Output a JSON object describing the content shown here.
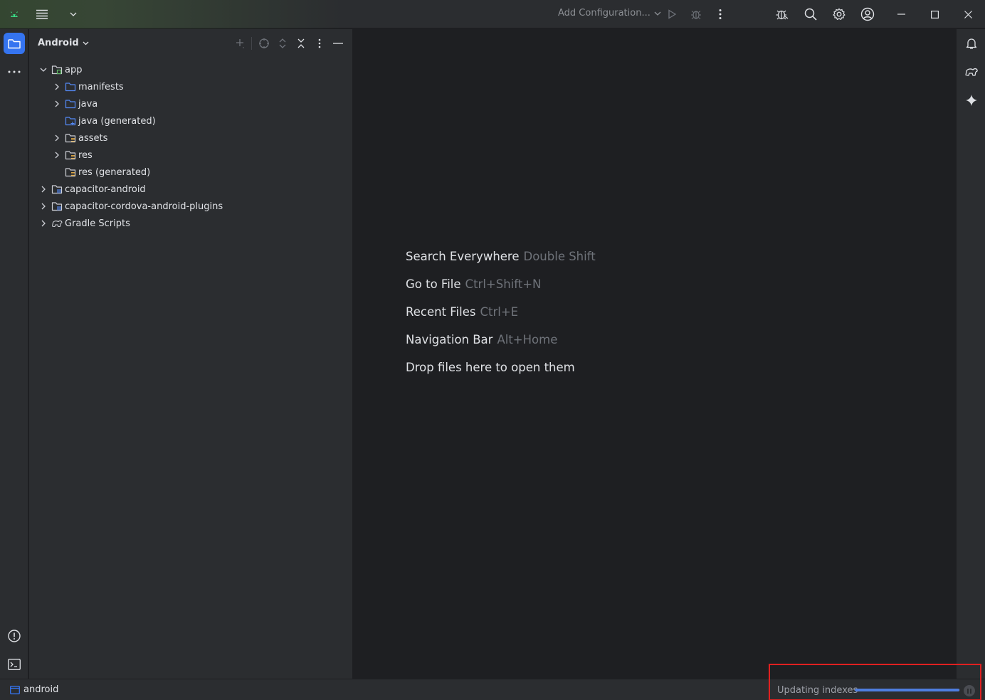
{
  "titlebar": {
    "run_config_label": "Add Configuration..."
  },
  "project_panel": {
    "view_mode": "Android",
    "tree": [
      {
        "label": "app",
        "depth": 0,
        "expanded": true,
        "has_chevron": true,
        "icon": "module-icon"
      },
      {
        "label": "manifests",
        "depth": 1,
        "expanded": false,
        "has_chevron": true,
        "icon": "folder-icon"
      },
      {
        "label": "java",
        "depth": 1,
        "expanded": false,
        "has_chevron": true,
        "icon": "folder-icon"
      },
      {
        "label": "java (generated)",
        "depth": 1,
        "expanded": false,
        "has_chevron": false,
        "icon": "generated-folder-icon"
      },
      {
        "label": "assets",
        "depth": 1,
        "expanded": false,
        "has_chevron": true,
        "icon": "resource-folder-icon"
      },
      {
        "label": "res",
        "depth": 1,
        "expanded": false,
        "has_chevron": true,
        "icon": "resource-folder-icon"
      },
      {
        "label": "res (generated)",
        "depth": 1,
        "expanded": false,
        "has_chevron": false,
        "icon": "resource-folder-icon"
      },
      {
        "label": "capacitor-android",
        "depth": 0,
        "expanded": false,
        "has_chevron": true,
        "icon": "library-module-icon"
      },
      {
        "label": "capacitor-cordova-android-plugins",
        "depth": 0,
        "expanded": false,
        "has_chevron": true,
        "icon": "library-module-icon"
      },
      {
        "label": "Gradle Scripts",
        "depth": 0,
        "expanded": false,
        "has_chevron": true,
        "icon": "gradle-icon"
      }
    ]
  },
  "editor_hints": [
    {
      "action": "Search Everywhere",
      "shortcut": "Double Shift"
    },
    {
      "action": "Go to File",
      "shortcut": "Ctrl+Shift+N"
    },
    {
      "action": "Recent Files",
      "shortcut": "Ctrl+E"
    },
    {
      "action": "Navigation Bar",
      "shortcut": "Alt+Home"
    },
    {
      "action": "Drop files here to open them",
      "shortcut": ""
    }
  ],
  "statusbar": {
    "project_name": "android",
    "progress_label": "Updating indexes",
    "progress_fraction": 0.99
  },
  "colors": {
    "accent": "#4f7ee0",
    "highlight_box": "#e02020",
    "android_green": "#3ddc84"
  }
}
